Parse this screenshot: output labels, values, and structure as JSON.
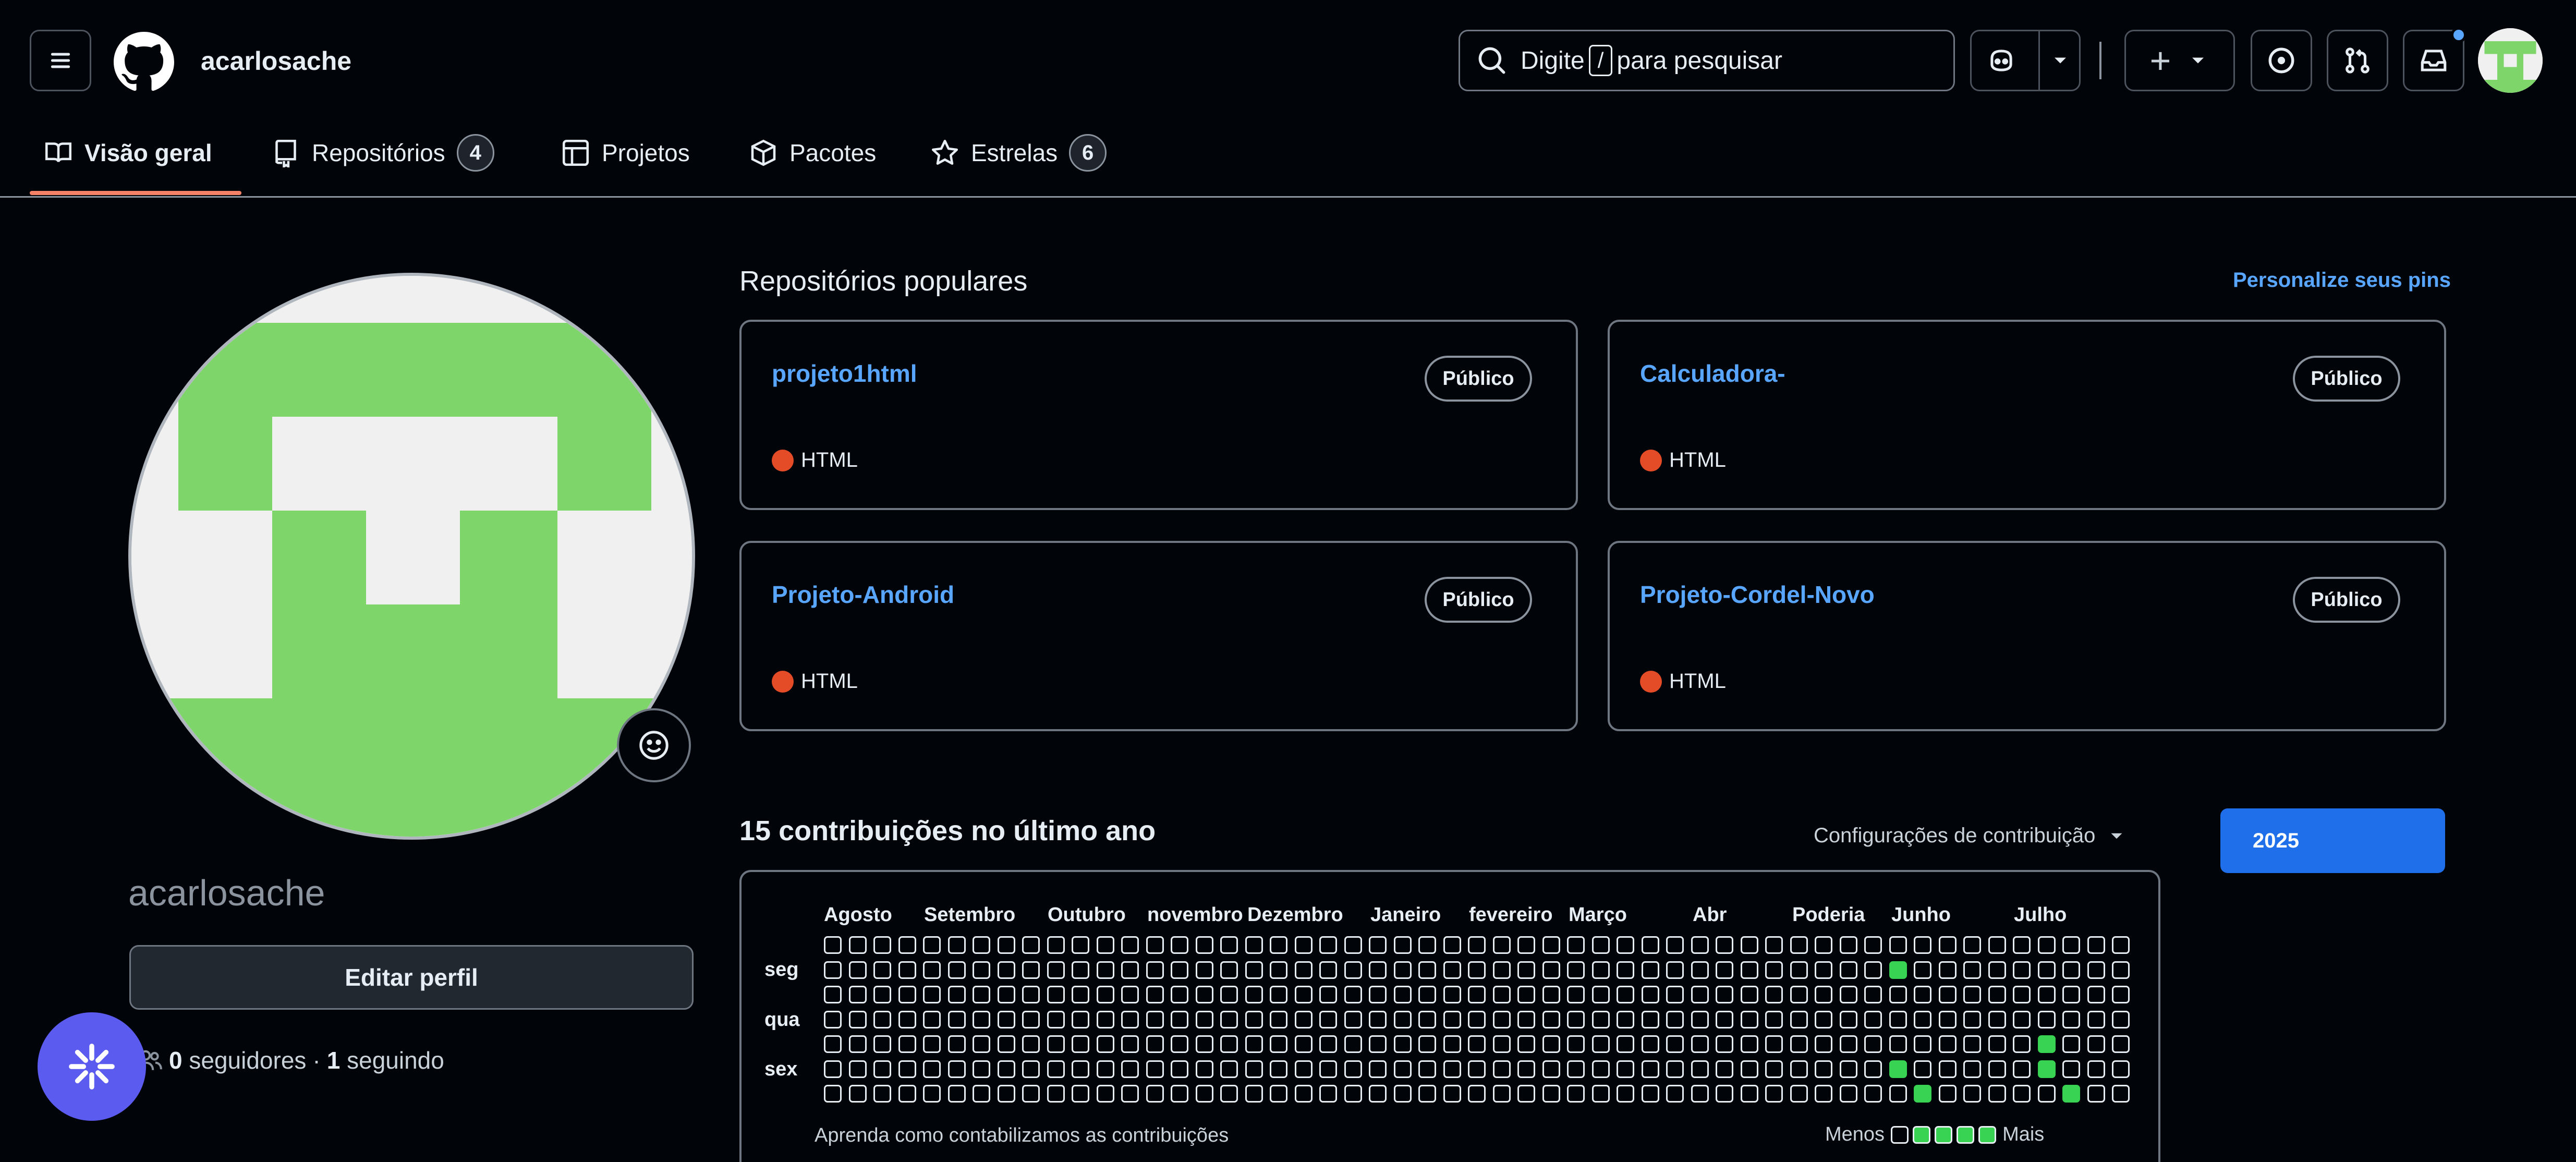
{
  "header": {
    "username": "acarlosache",
    "search": {
      "before": "Digite",
      "key": "/",
      "after": "para pesquisar"
    },
    "plus": "+"
  },
  "tabs": [
    {
      "label": "Visão geral"
    },
    {
      "label": "Repositórios",
      "count": "4"
    },
    {
      "label": "Projetos"
    },
    {
      "label": "Pacotes"
    },
    {
      "label": "Estrelas",
      "count": "6"
    }
  ],
  "profile": {
    "username": "acarlosache",
    "edit_label": "Editar perfil",
    "followers_count": "0",
    "followers_label": "seguidores",
    "separator": "·",
    "following_count": "1",
    "following_label": "seguindo"
  },
  "popular": {
    "title": "Repositórios populares",
    "customize": "Personalize seus pins",
    "repos": [
      {
        "name": "projeto1html",
        "visibility": "Público",
        "language": "HTML"
      },
      {
        "name": "Calculadora-",
        "visibility": "Público",
        "language": "HTML"
      },
      {
        "name": "Projeto-Android",
        "visibility": "Público",
        "language": "HTML"
      },
      {
        "name": "Projeto-Cordel-Novo",
        "visibility": "Público",
        "language": "HTML"
      }
    ]
  },
  "contrib": {
    "title": "15 contribuições no último ano",
    "settings": "Configurações de contribuição",
    "year": "2025",
    "months": [
      "Agosto",
      "Setembro",
      "Outubro",
      "novembro",
      "Dezembro",
      "Janeiro",
      "fevereiro",
      "Março",
      "Abr",
      "Poderia",
      "Junho",
      "Julho"
    ],
    "days": [
      "seg",
      "qua",
      "sex"
    ],
    "learn": "Aprenda como contabilizamos as contribuições",
    "less": "Menos",
    "more": "Mais",
    "active_cells": [
      [
        43,
        1
      ],
      [
        49,
        4
      ],
      [
        43,
        5
      ],
      [
        49,
        5
      ],
      [
        44,
        6
      ],
      [
        50,
        6
      ]
    ]
  },
  "colors": {
    "background": "#010409",
    "link": "#58a6ff",
    "html_language": "#e34c26",
    "contribution": "#39d353",
    "year_button": "#1f6feb",
    "avatar_green": "#7ed66a",
    "avatar_light": "#f0f0f0"
  },
  "icons": [
    "menu-icon",
    "github-logo-icon",
    "search-icon",
    "copilot-icon",
    "plus-icon",
    "issue-icon",
    "pull-request-icon",
    "inbox-icon",
    "book-icon",
    "repo-icon",
    "project-icon",
    "package-icon",
    "star-icon",
    "smiley-icon",
    "people-icon",
    "sparkle-icon"
  ]
}
